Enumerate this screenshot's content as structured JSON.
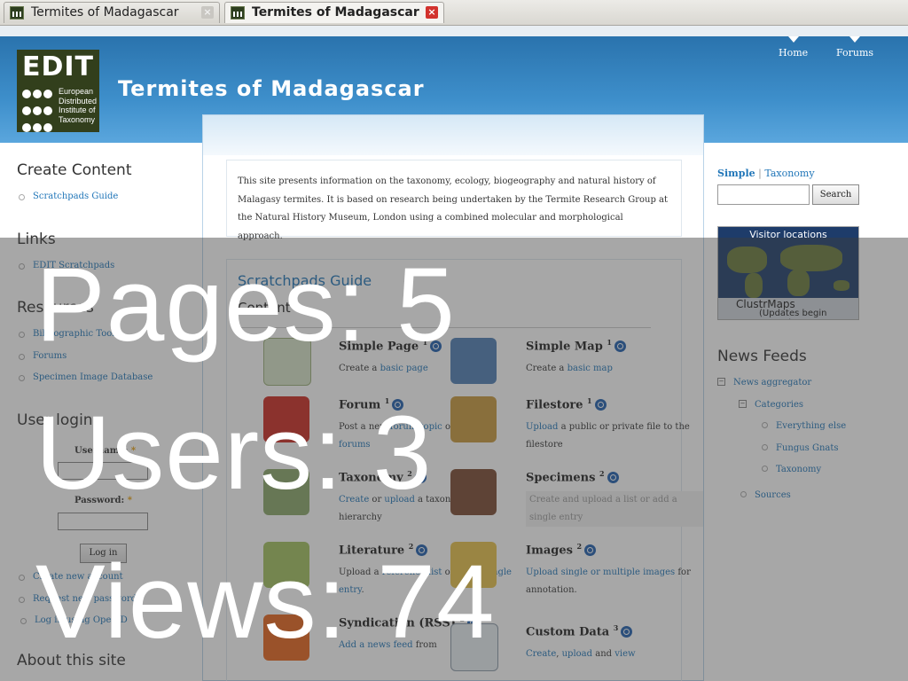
{
  "tabs": [
    {
      "title": "Termites of Madagascar",
      "active": false
    },
    {
      "title": "Termites of Madagascar",
      "active": true
    }
  ],
  "site": {
    "logo_text": "EDIT",
    "logo_desc": [
      "European",
      "Distributed",
      "Institute of",
      "Taxonomy"
    ],
    "title": "Termites of Madagascar",
    "nav": [
      "Home",
      "Forums"
    ]
  },
  "intro": "This site presents information on the taxonomy, ecology, biogeography and natural history of Malagasy termites. It is based on research being undertaken by the Termite Research Group at the Natural History Museum, London using a combined molecular and morphological approach.",
  "guide": {
    "title": "Scratchpads Guide",
    "subtitle": "Content",
    "items": [
      {
        "name": "Simple Page",
        "count": "1",
        "desc": [
          "Create a ",
          "basic page"
        ]
      },
      {
        "name": "Simple Map",
        "count": "1",
        "desc": [
          "Create a ",
          "basic map"
        ]
      },
      {
        "name": "Forum",
        "count": "1",
        "desc": [
          "Post a new ",
          "forum topic",
          " or ",
          "read the forums"
        ]
      },
      {
        "name": "Filestore",
        "count": "1",
        "desc": [
          "",
          "Upload",
          " a public or private file to the filestore"
        ]
      },
      {
        "name": "Taxonomy",
        "count": "2",
        "desc": [
          "",
          "Create",
          " or ",
          "upload",
          " a taxonomic hierarchy"
        ]
      },
      {
        "name": "Specimens",
        "count": "2",
        "desc": [
          "Create and upload a list or add a single entry"
        ]
      },
      {
        "name": "Literature",
        "count": "2",
        "desc": [
          "Upload a ",
          "reference list",
          " or add a ",
          "single entry",
          "."
        ]
      },
      {
        "name": "Images",
        "count": "2",
        "desc": [
          "",
          "Upload single or multiple images",
          " for annotation."
        ]
      },
      {
        "name": "Syndication (RSS)",
        "count": "2",
        "desc": [
          "",
          "Add a news feed",
          " from"
        ]
      },
      {
        "name": "Custom Data",
        "count": "3",
        "desc": [
          "",
          "Create",
          ", ",
          "upload",
          " and ",
          "view"
        ]
      }
    ]
  },
  "left": {
    "create_heading": "Create Content",
    "create_items": [
      "Scratchpads Guide"
    ],
    "links_heading": "Links",
    "links_items": [
      "EDIT Scratchpads"
    ],
    "resources_heading": "Resources",
    "resources_items": [
      "Bibliographic Tool",
      "Forums",
      "Specimen Image Database"
    ],
    "login_heading": "User login",
    "username_label": "Username:",
    "password_label": "Password:",
    "required_mark": "*",
    "login_button": "Log in",
    "account_links": [
      "Create new account",
      "Request new password",
      "Log in using OpenID"
    ],
    "about_heading": "About this site"
  },
  "right": {
    "search_modes": [
      "Simple",
      "Taxonomy"
    ],
    "search_button": "Search",
    "map_title": "Visitor locations",
    "map_brand": "ClustrMaps",
    "map_note": "(Updates begin soon...)",
    "news_heading": "News Feeds",
    "news_tree": [
      "News aggregator",
      "Categories",
      "Everything else",
      "Fungus Gnats",
      "Taxonomy",
      "Sources"
    ]
  },
  "stats": {
    "pages": "Pages: 5",
    "users": "Users: 3",
    "views": "Views: 74"
  },
  "colors": {
    "header": "#3e8fcb",
    "link": "#1f75b8",
    "logo_bg": "#323f1c"
  }
}
